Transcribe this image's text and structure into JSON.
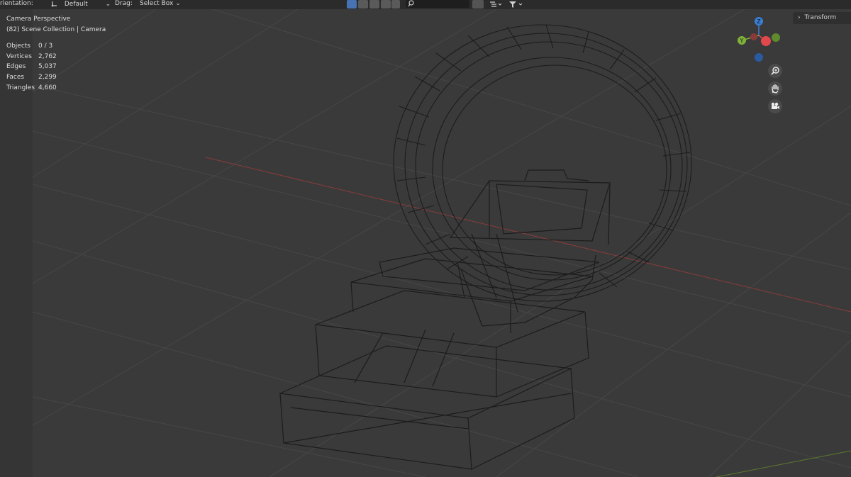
{
  "header": {
    "orientation_label": "rientation:",
    "orientation_value": "Default",
    "drag_label": "Drag:",
    "drag_value": "Select Box"
  },
  "viewport": {
    "view_name": "Camera Perspective",
    "collection": "(82) Scene Collection | Camera"
  },
  "stats": [
    {
      "label": "Objects",
      "value": "0 / 3"
    },
    {
      "label": "Vertices",
      "value": "2,762"
    },
    {
      "label": "Edges",
      "value": "5,037"
    },
    {
      "label": "Faces",
      "value": "2,299"
    },
    {
      "label": "Triangles",
      "value": "4,660"
    }
  ],
  "sidebar": {
    "transform_label": "Transform"
  },
  "gizmo": {
    "z": "Z",
    "y": "Y",
    "x": "X"
  },
  "icons": {
    "orientation": "transform-orientation-icon",
    "zoom": "zoom-icon",
    "pan": "hand-icon",
    "camera": "camera-icon"
  },
  "colors": {
    "x_axis": "#e0484e",
    "y_axis": "#7fb23a",
    "z_axis": "#3a7fd6",
    "active": "#4772b3"
  }
}
